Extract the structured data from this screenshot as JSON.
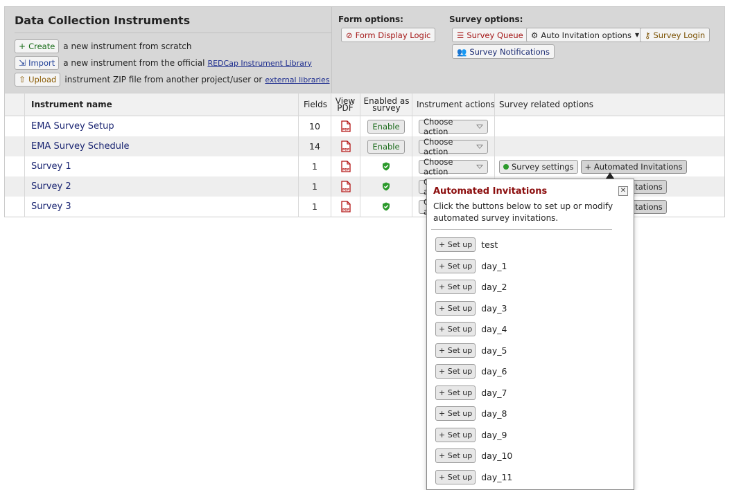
{
  "header": {
    "title": "Data Collection Instruments",
    "create": {
      "button": "Create",
      "text": "a new instrument from scratch"
    },
    "import": {
      "button": "Import",
      "text": "a new instrument from the official",
      "link": "REDCap Instrument Library"
    },
    "upload": {
      "button": "Upload",
      "text": "instrument ZIP file from another project/user or",
      "link": "external libraries"
    }
  },
  "form_options": {
    "label": "Form options:",
    "form_display_logic": "Form Display Logic"
  },
  "survey_options": {
    "label": "Survey options:",
    "survey_queue": "Survey Queue",
    "auto_invitation_options": "Auto Invitation options",
    "survey_login": "Survey Login",
    "survey_notifications": "Survey Notifications"
  },
  "table": {
    "headers": {
      "instrument_name": "Instrument name",
      "fields": "Fields",
      "view_pdf_1": "View",
      "view_pdf_2": "PDF",
      "enabled_1": "Enabled as",
      "enabled_2": "survey",
      "instrument_actions": "Instrument actions",
      "survey_related": "Survey related options"
    },
    "pdf_badge": "PDF",
    "enable_label": "Enable",
    "choose_action": "Choose action",
    "survey_settings": "Survey settings",
    "automated_invitations": "+ Automated Invitations",
    "partial_invitations": "itations",
    "rows": [
      {
        "name": "EMA Survey Setup",
        "fields": "10"
      },
      {
        "name": "EMA Survey Schedule",
        "fields": "14"
      },
      {
        "name": "Survey 1",
        "fields": "1"
      },
      {
        "name": "Survey 2",
        "fields": "1"
      },
      {
        "name": "Survey 3",
        "fields": "1"
      }
    ]
  },
  "popup": {
    "title": "Automated Invitations",
    "description": "Click the buttons below to set up or modify automated survey invitations.",
    "setup_label": "+ Set up",
    "items": [
      "test",
      "day_1",
      "day_2",
      "day_3",
      "day_4",
      "day_5",
      "day_6",
      "day_7",
      "day_8",
      "day_9",
      "day_10",
      "day_11"
    ]
  },
  "colors": {
    "header_bg": "#d7d7d7",
    "popup_title": "#8b0d0d",
    "link": "#1a2572",
    "enable_green": "#1c6b1c"
  }
}
